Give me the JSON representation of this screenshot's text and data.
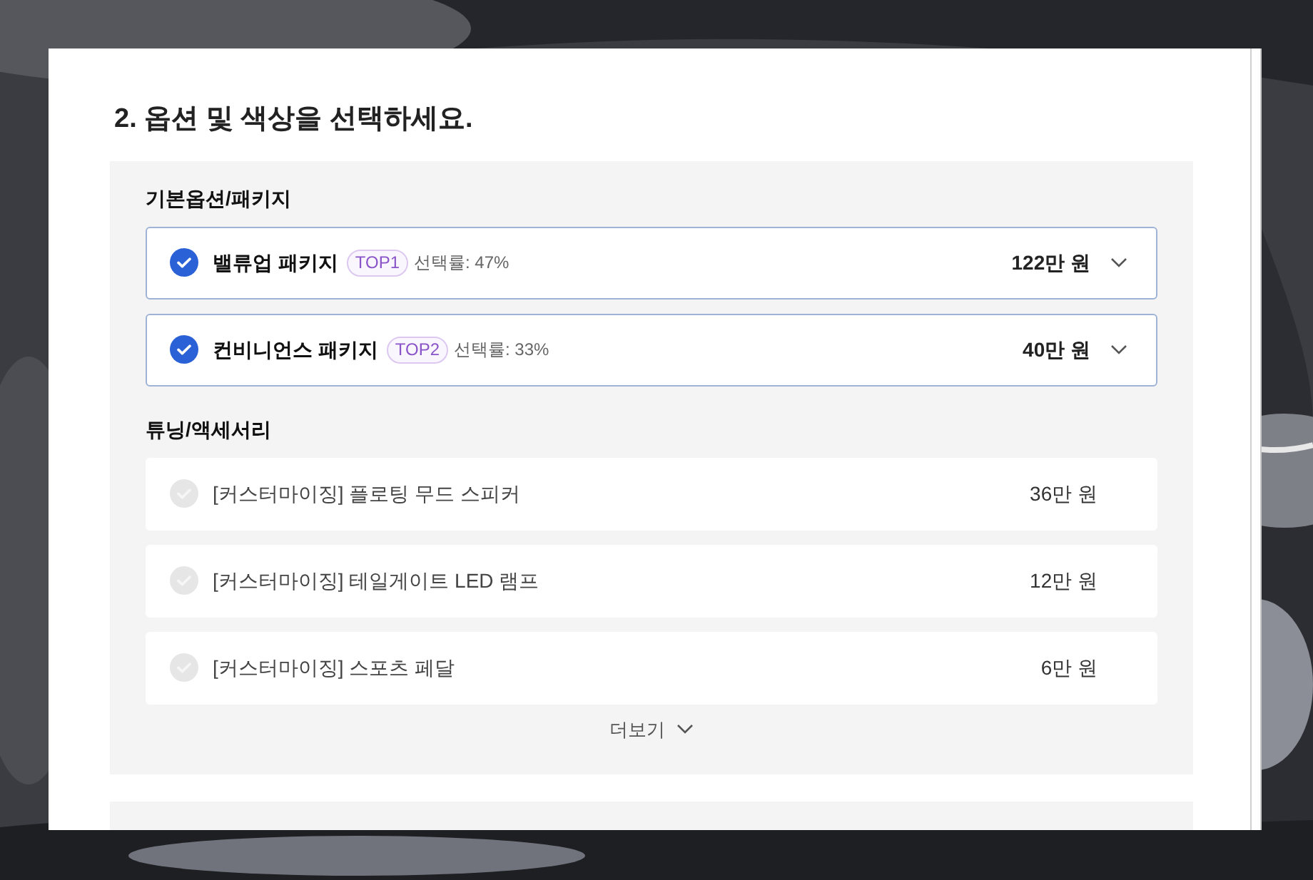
{
  "heading": "2. 옵션 및 색상을 선택하세요.",
  "sections": [
    {
      "title": "기본옵션/패키지",
      "options": [
        {
          "kind": "package",
          "name": "밸류업 패키지",
          "badge": "TOP1",
          "rate": "선택률: 47%",
          "price": "122만 원",
          "selected": true
        },
        {
          "kind": "package",
          "name": "컨비니언스 패키지",
          "badge": "TOP2",
          "rate": "선택률: 33%",
          "price": "40만 원",
          "selected": true
        }
      ]
    },
    {
      "title": "튜닝/액세서리",
      "options": [
        {
          "kind": "accessory",
          "name": "[커스터마이징] 플로팅 무드 스피커",
          "price": "36만 원",
          "selected": false
        },
        {
          "kind": "accessory",
          "name": "[커스터마이징] 테일게이트 LED 램프",
          "price": "12만 원",
          "selected": false
        },
        {
          "kind": "accessory",
          "name": "[커스터마이징] 스포츠 페달",
          "price": "6만 원",
          "selected": false
        }
      ],
      "more": "더보기"
    }
  ]
}
